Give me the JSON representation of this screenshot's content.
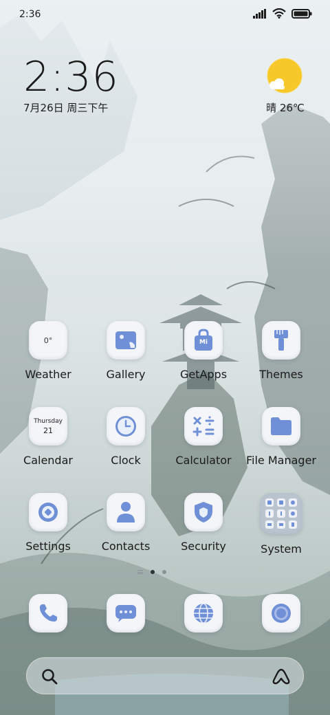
{
  "status_bar": {
    "time": "2:36"
  },
  "clock_widget": {
    "time": "2:36",
    "date": "7月26日 周三下午"
  },
  "weather_widget": {
    "label": "晴 26℃"
  },
  "apps": {
    "weather": {
      "label": "Weather",
      "badge": "0°"
    },
    "gallery": {
      "label": "Gallery"
    },
    "getapps": {
      "label": "GetApps",
      "badge": "Mi"
    },
    "themes": {
      "label": "Themes"
    },
    "calendar": {
      "label": "Calendar",
      "weekday": "Thursday",
      "day": "21"
    },
    "clock": {
      "label": "Clock"
    },
    "calculator": {
      "label": "Calculator"
    },
    "file_manager": {
      "label": "File Manager"
    },
    "settings": {
      "label": "Settings"
    },
    "contacts": {
      "label": "Contacts"
    },
    "security": {
      "label": "Security"
    },
    "system": {
      "label": "System"
    }
  },
  "dock": [
    "phone-icon",
    "messages-icon",
    "browser-icon",
    "camera-icon"
  ],
  "colors": {
    "icon_accent": "#6f8fd6",
    "sun": "#f7c82a"
  }
}
